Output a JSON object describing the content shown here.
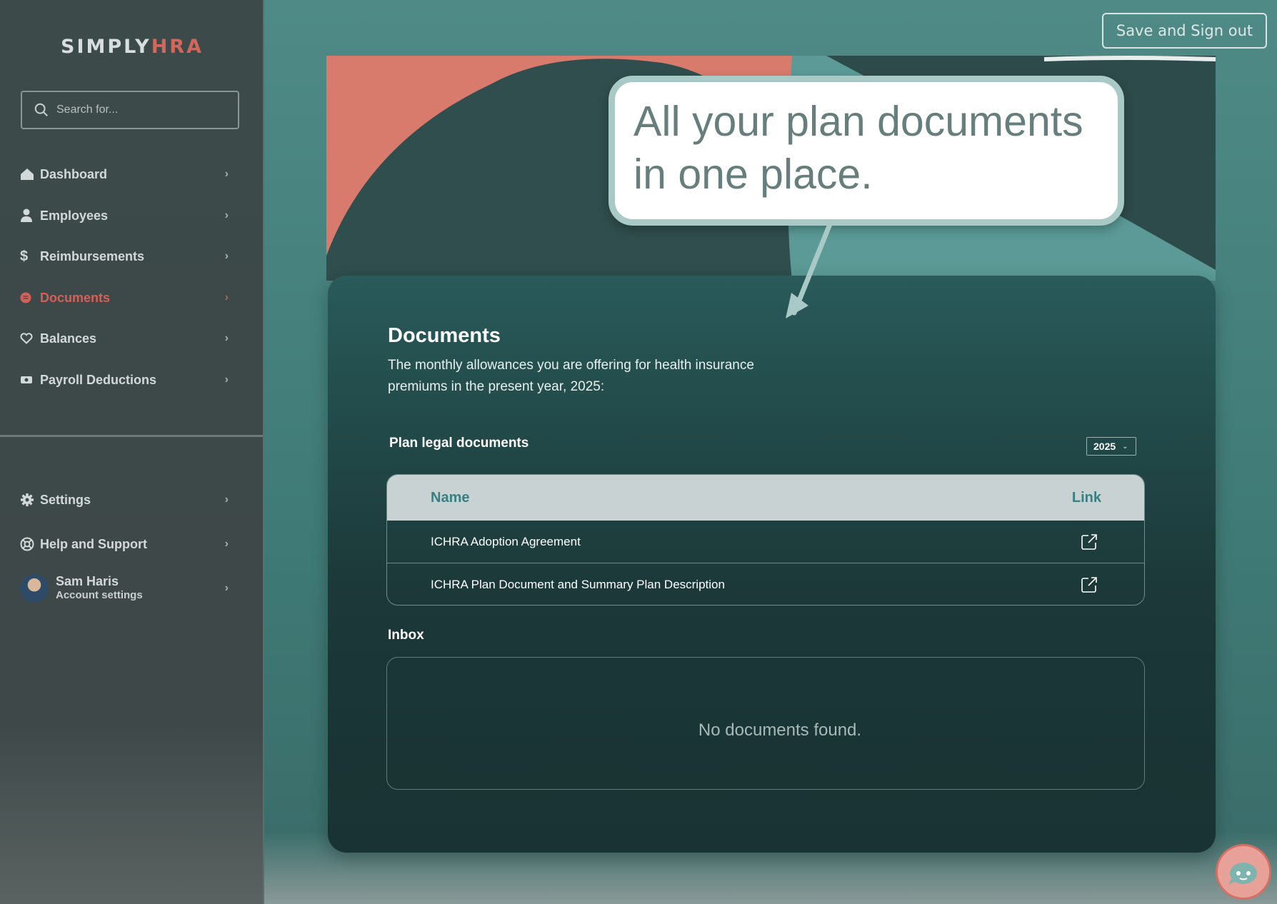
{
  "brand": {
    "part1": "SIMPLY",
    "part2": "HRA",
    "accent": "#d4675c"
  },
  "search": {
    "placeholder": "Search for..."
  },
  "nav": {
    "items": [
      {
        "label": "Dashboard",
        "icon": "home-icon"
      },
      {
        "label": "Employees",
        "icon": "person-icon"
      },
      {
        "label": "Reimbursements",
        "icon": "dollar-icon"
      },
      {
        "label": "Documents",
        "icon": "document-icon",
        "active": true
      },
      {
        "label": "Balances",
        "icon": "heart-icon"
      },
      {
        "label": "Payroll Deductions",
        "icon": "money-icon"
      }
    ],
    "bottom": [
      {
        "label": "Settings",
        "icon": "gear-icon"
      },
      {
        "label": "Help and Support",
        "icon": "lifebuoy-icon"
      }
    ],
    "user": {
      "name": "Sam Haris",
      "sub": "Account settings"
    }
  },
  "header": {
    "signout_label": "Save and Sign out"
  },
  "callout": {
    "text": "All your plan documents in one place."
  },
  "main": {
    "title": "Documents",
    "description": "The monthly allowances you are offering for health insurance premiums in the present year, 2025:",
    "legal_title": "Plan legal documents",
    "year_selected": "2025",
    "table": {
      "columns": [
        "Name",
        "Link"
      ],
      "rows": [
        {
          "name": "ICHRA Adoption Agreement",
          "link_icon": "external-link-icon"
        },
        {
          "name": "ICHRA Plan Document and Summary Plan Description",
          "link_icon": "external-link-icon"
        }
      ]
    },
    "inbox_title": "Inbox",
    "inbox_empty": "No documents found."
  },
  "colors": {
    "sidebar_bg": "#3c4a4a",
    "page_bg": "#4f8a86",
    "card_bg": "#1c3838",
    "active_nav": "#d65f56",
    "table_header_bg": "#c8d2d2",
    "table_header_text": "#3a8082"
  }
}
